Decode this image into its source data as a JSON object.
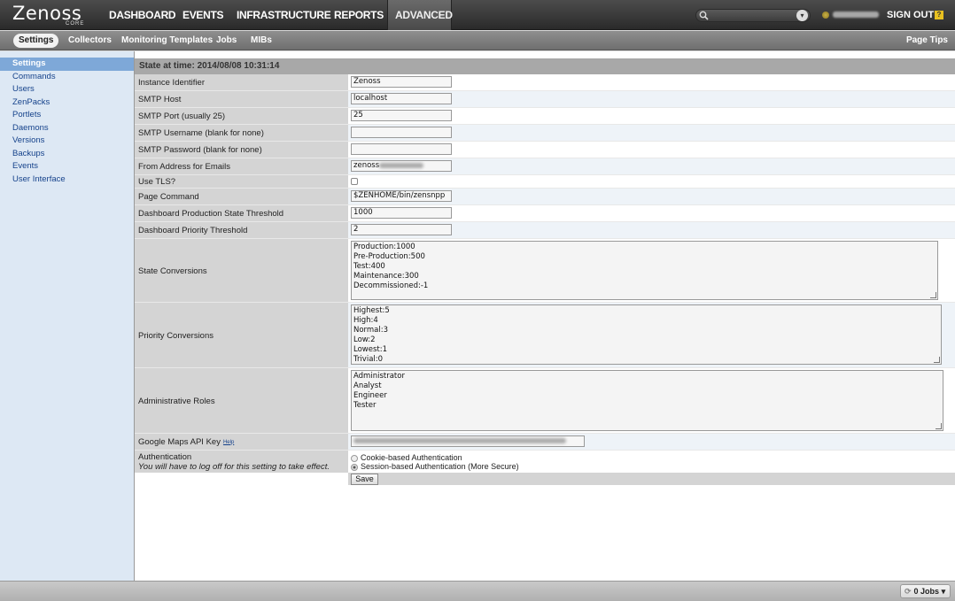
{
  "app": {
    "logo_text": "Zenoss",
    "logo_sub": "CORE"
  },
  "topnav": {
    "items": [
      "DASHBOARD",
      "EVENTS",
      "INFRASTRUCTURE",
      "REPORTS",
      "ADVANCED"
    ],
    "active": "ADVANCED",
    "sign_out": "SIGN OUT",
    "help_glyph": "?"
  },
  "subnav": {
    "items": [
      "Settings",
      "Collectors",
      "Monitoring Templates",
      "Jobs",
      "MIBs"
    ],
    "active": "Settings",
    "page_tips": "Page Tips"
  },
  "sidebar": {
    "items": [
      "Settings",
      "Commands",
      "Users",
      "ZenPacks",
      "Portlets",
      "Daemons",
      "Versions",
      "Backups",
      "Events",
      "User Interface"
    ],
    "active": "Settings"
  },
  "main": {
    "state_header": "State at time: 2014/08/08 10:31:14",
    "fields": {
      "instance_identifier": {
        "label": "Instance Identifier",
        "value": "Zenoss"
      },
      "smtp_host": {
        "label": "SMTP Host",
        "value": "localhost"
      },
      "smtp_port": {
        "label": "SMTP Port (usually 25)",
        "value": "25"
      },
      "smtp_username": {
        "label": "SMTP Username (blank for none)",
        "value": ""
      },
      "smtp_password": {
        "label": "SMTP Password (blank for none)",
        "value": ""
      },
      "from_address": {
        "label": "From Address for Emails",
        "value": "zenoss"
      },
      "use_tls": {
        "label": "Use TLS?",
        "checked": false
      },
      "page_command": {
        "label": "Page Command",
        "value": "$ZENHOME/bin/zensnpp"
      },
      "dashboard_production_threshold": {
        "label": "Dashboard Production State Threshold",
        "value": "1000"
      },
      "dashboard_priority_threshold": {
        "label": "Dashboard Priority Threshold",
        "value": "2"
      },
      "state_conversions": {
        "label": "State Conversions",
        "value": "Production:1000\nPre-Production:500\nTest:400\nMaintenance:300\nDecommissioned:-1"
      },
      "priority_conversions": {
        "label": "Priority Conversions",
        "value": "Highest:5\nHigh:4\nNormal:3\nLow:2\nLowest:1\nTrivial:0"
      },
      "administrative_roles": {
        "label": "Administrative Roles",
        "value": "Administrator\nAnalyst\nEngineer\nTester"
      },
      "google_maps_key": {
        "label": "Google Maps API Key",
        "help": "Help",
        "value": ""
      },
      "authentication": {
        "label": "Authentication",
        "note": "You will have to log off for this setting to take effect.",
        "options": [
          "Cookie-based Authentication",
          "Session-based Authentication (More Secure)"
        ],
        "selected": "Session-based Authentication (More Secure)"
      }
    },
    "save_label": "Save"
  },
  "footer": {
    "jobs_label": "0 Jobs"
  }
}
